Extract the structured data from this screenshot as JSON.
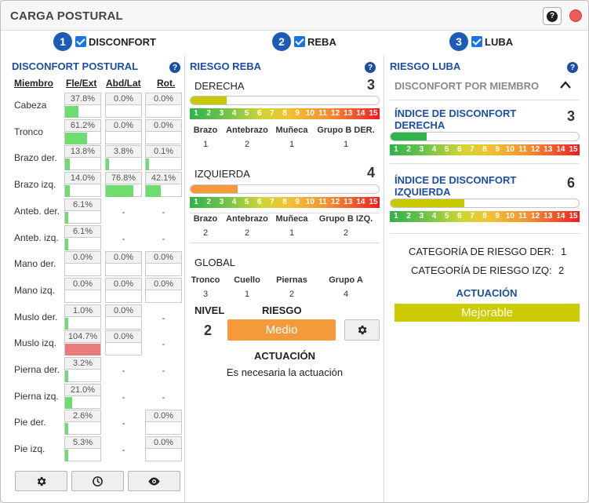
{
  "window": {
    "title": "CARGA POSTURAL",
    "help_icon": "?"
  },
  "steps": [
    {
      "num": "1",
      "label": "DISCONFORT",
      "checked": true
    },
    {
      "num": "2",
      "label": "REBA",
      "checked": true
    },
    {
      "num": "3",
      "label": "LUBA",
      "checked": true
    }
  ],
  "disconfort": {
    "title": "DISCONFORT POSTURAL",
    "headers": {
      "miembro": "Miembro",
      "fle": "Fle/Ext",
      "abd": "Abd/Lat",
      "rot": "Rot."
    },
    "rows": [
      {
        "name": "Cabeza",
        "fle": "37.8%",
        "fle_v": 37.8,
        "abd": "0.0%",
        "abd_v": 0,
        "rot": "0.0%",
        "rot_v": 0
      },
      {
        "name": "Tronco",
        "fle": "61.2%",
        "fle_v": 61.2,
        "abd": "0.0%",
        "abd_v": 0,
        "rot": "0.0%",
        "rot_v": 0
      },
      {
        "name": "Brazo der.",
        "fle": "13.8%",
        "fle_v": 13.8,
        "abd": "3.8%",
        "abd_v": 3.8,
        "rot": "0.1%",
        "rot_v": 0.1
      },
      {
        "name": "Brazo izq.",
        "fle": "14.0%",
        "fle_v": 14.0,
        "abd": "76.8%",
        "abd_v": 76.8,
        "rot": "42.1%",
        "rot_v": 42.1
      },
      {
        "name": "Anteb. der.",
        "fle": "6.1%",
        "fle_v": 6.1,
        "abd": "-",
        "rot": "-"
      },
      {
        "name": "Anteb. izq.",
        "fle": "6.1%",
        "fle_v": 6.1,
        "abd": "-",
        "rot": "-"
      },
      {
        "name": "Mano der.",
        "fle": "0.0%",
        "fle_v": 0,
        "abd": "0.0%",
        "abd_v": 0,
        "rot": "0.0%",
        "rot_v": 0
      },
      {
        "name": "Mano izq.",
        "fle": "0.0%",
        "fle_v": 0,
        "abd": "0.0%",
        "abd_v": 0,
        "rot": "0.0%",
        "rot_v": 0
      },
      {
        "name": "Muslo der.",
        "fle": "1.0%",
        "fle_v": 1.0,
        "abd": "0.0%",
        "abd_v": 0,
        "rot": "-"
      },
      {
        "name": "Muslo izq.",
        "fle": "104.7%",
        "fle_v": 104.7,
        "fle_over": true,
        "abd": "0.0%",
        "abd_v": 0,
        "rot": "-"
      },
      {
        "name": "Pierna der.",
        "fle": "3.2%",
        "fle_v": 3.2,
        "abd": "-",
        "rot": "-"
      },
      {
        "name": "Pierna izq.",
        "fle": "21.0%",
        "fle_v": 21.0,
        "abd": "-",
        "rot": "-"
      },
      {
        "name": "Pie der.",
        "fle": "2.6%",
        "fle_v": 2.6,
        "abd": "-",
        "rot": "0.0%",
        "rot_v": 0
      },
      {
        "name": "Pie izq.",
        "fle": "5.3%",
        "fle_v": 5.3,
        "abd": "-",
        "rot": "0.0%",
        "rot_v": 0
      }
    ],
    "buttons": [
      "gear-icon",
      "clock-icon",
      "eye-icon"
    ]
  },
  "reba": {
    "title": "RIESGO REBA",
    "scale": [
      "1",
      "2",
      "3",
      "4",
      "5",
      "6",
      "7",
      "8",
      "9",
      "10",
      "11",
      "12",
      "13",
      "14",
      "15"
    ],
    "derecha": {
      "label": "DERECHA",
      "score": "3",
      "fill_fraction": 0.19,
      "fill_color": "#c8c800",
      "cols": [
        "Brazo",
        "Antebrazo",
        "Muñeca",
        "Grupo B DER."
      ],
      "vals": [
        "1",
        "2",
        "1",
        "1"
      ]
    },
    "izquierda": {
      "label": "IZQUIERDA",
      "score": "4",
      "fill_fraction": 0.25,
      "fill_color": "#f59a3b",
      "cols": [
        "Brazo",
        "Antebrazo",
        "Muñeca",
        "Grupo B IZQ."
      ],
      "vals": [
        "2",
        "2",
        "1",
        "2"
      ]
    },
    "global": {
      "label": "GLOBAL",
      "cols": [
        "Tronco",
        "Cuello",
        "Piernas",
        "Grupo A"
      ],
      "vals": [
        "3",
        "1",
        "2",
        "4"
      ]
    },
    "nivel_label": "NIVEL",
    "nivel": "2",
    "riesgo_label": "RIESGO",
    "riesgo": "Medio",
    "actuacion_label": "ACTUACIÓN",
    "actuacion": "Es necesaria la actuación"
  },
  "luba": {
    "title": "RIESGO LUBA",
    "section": "DISCONFORT POR MIEMBRO",
    "der": {
      "title_1": "ÍNDICE DE DISCONFORT",
      "title_2": "DERECHA",
      "score": "3",
      "fill_fraction": 0.19,
      "fill_color": "#2fb34a"
    },
    "izq": {
      "title_1": "ÍNDICE DE DISCONFORT",
      "title_2": "IZQUIERDA",
      "score": "6",
      "fill_fraction": 0.39,
      "fill_color": "#c8c800"
    },
    "cat_der_label": "CATEGORÍA DE RIESGO DER:",
    "cat_der": "1",
    "cat_izq_label": "CATEGORÍA DE RIESGO IZQ:",
    "cat_izq": "2",
    "actuacion_label": "ACTUACIÓN",
    "actuacion": "Mejorable"
  }
}
